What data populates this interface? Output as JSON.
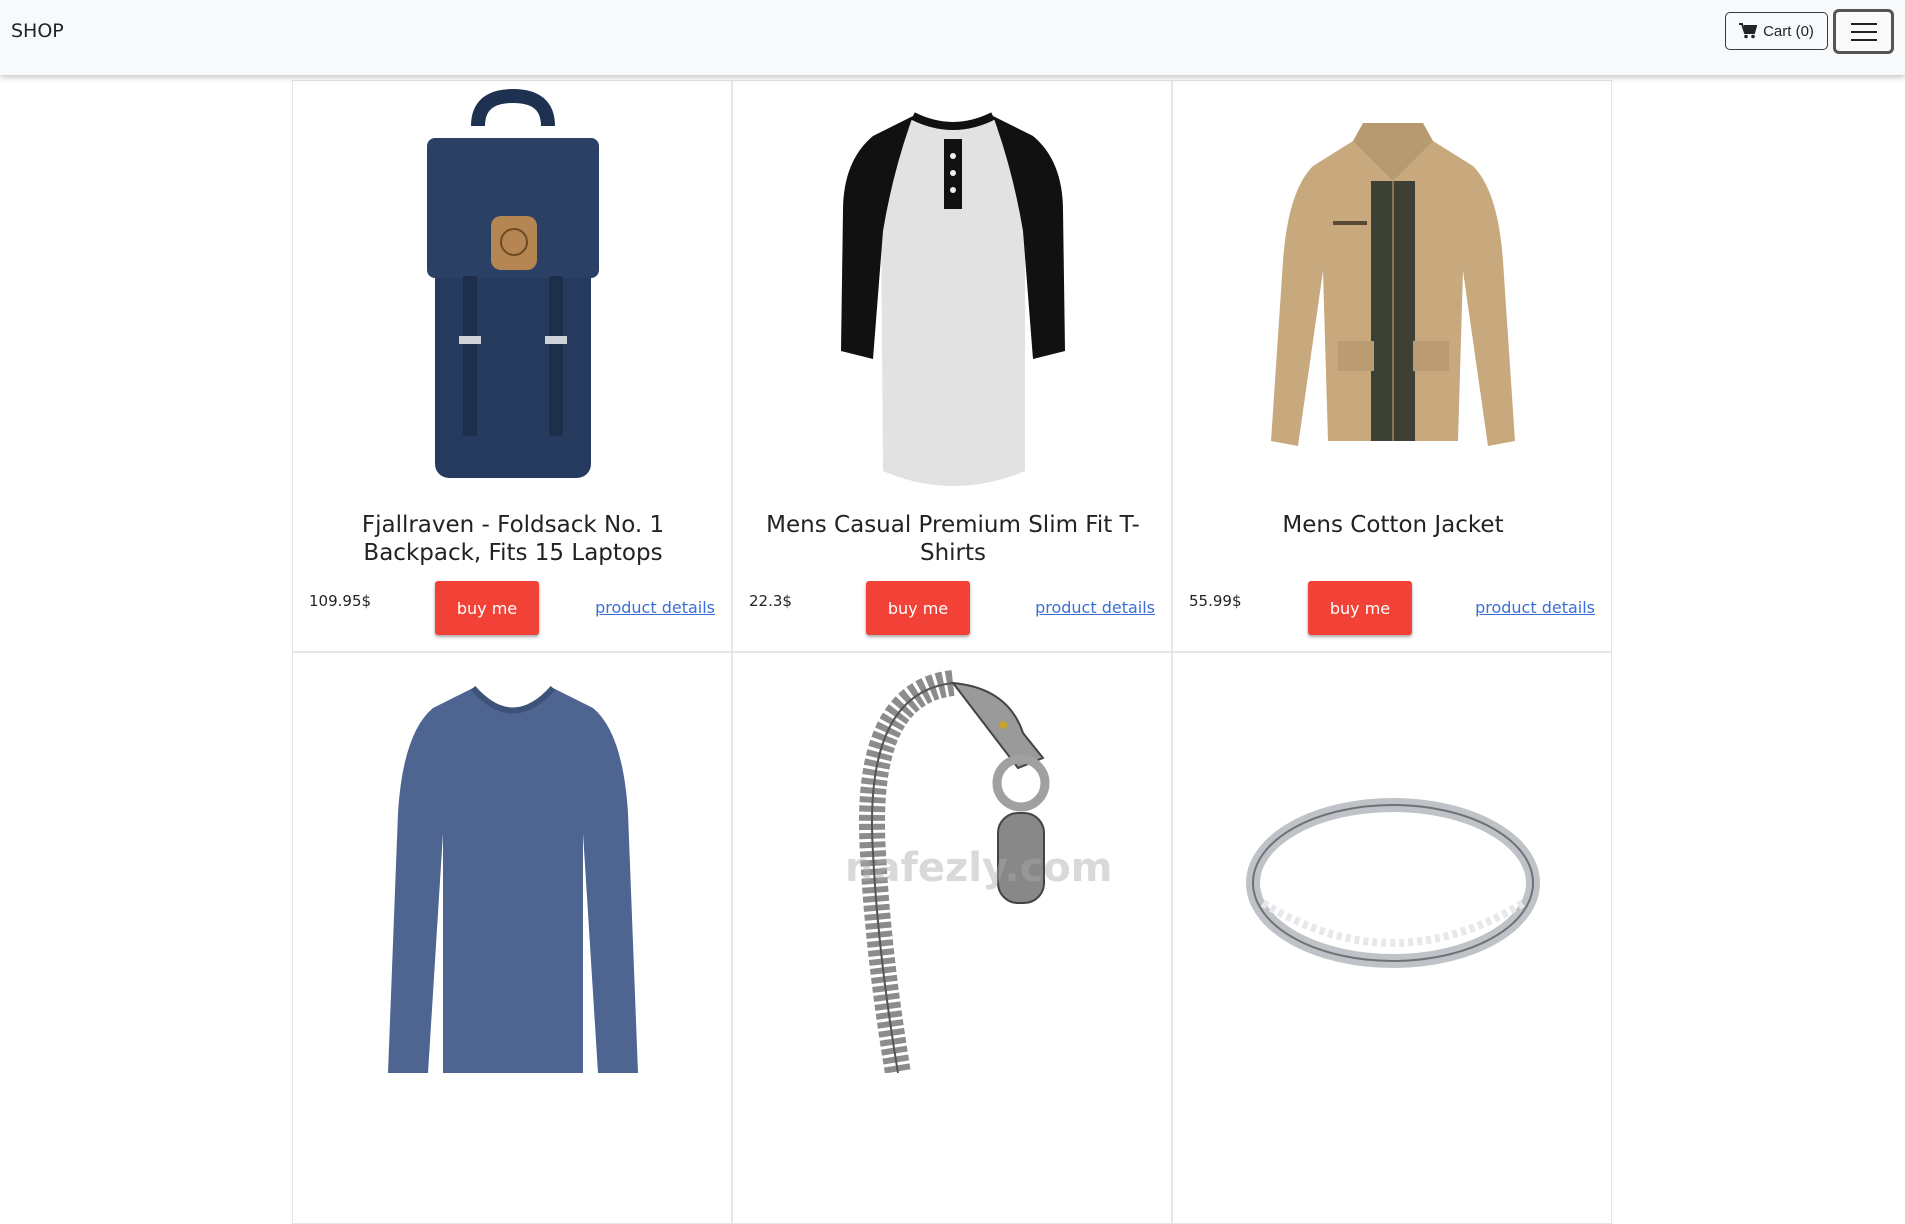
{
  "navbar": {
    "brand": "SHOP",
    "cart_label": "Cart (0)",
    "menu_icon": "hamburger-icon"
  },
  "products": [
    {
      "title": "Fjallraven - Foldsack No. 1 Backpack, Fits 15 Laptops",
      "price": "109.95$",
      "buy_label": "buy me",
      "details_label": "product details",
      "image_icon": "backpack-image"
    },
    {
      "title": "Mens Casual Premium Slim Fit T-Shirts",
      "price": "22.3$",
      "buy_label": "buy me",
      "details_label": "product details",
      "image_icon": "tshirt-image"
    },
    {
      "title": "Mens Cotton Jacket",
      "price": "55.99$",
      "buy_label": "buy me",
      "details_label": "product details",
      "image_icon": "jacket-image"
    },
    {
      "image_icon": "longsleeve-shirt-image"
    },
    {
      "image_icon": "bracelet-image"
    },
    {
      "image_icon": "ring-image"
    }
  ],
  "colors": {
    "buy_button": "#f24237",
    "link": "#3b6fd6",
    "navbar_bg": "#f8f9fa"
  },
  "watermark": "nafezly.com"
}
